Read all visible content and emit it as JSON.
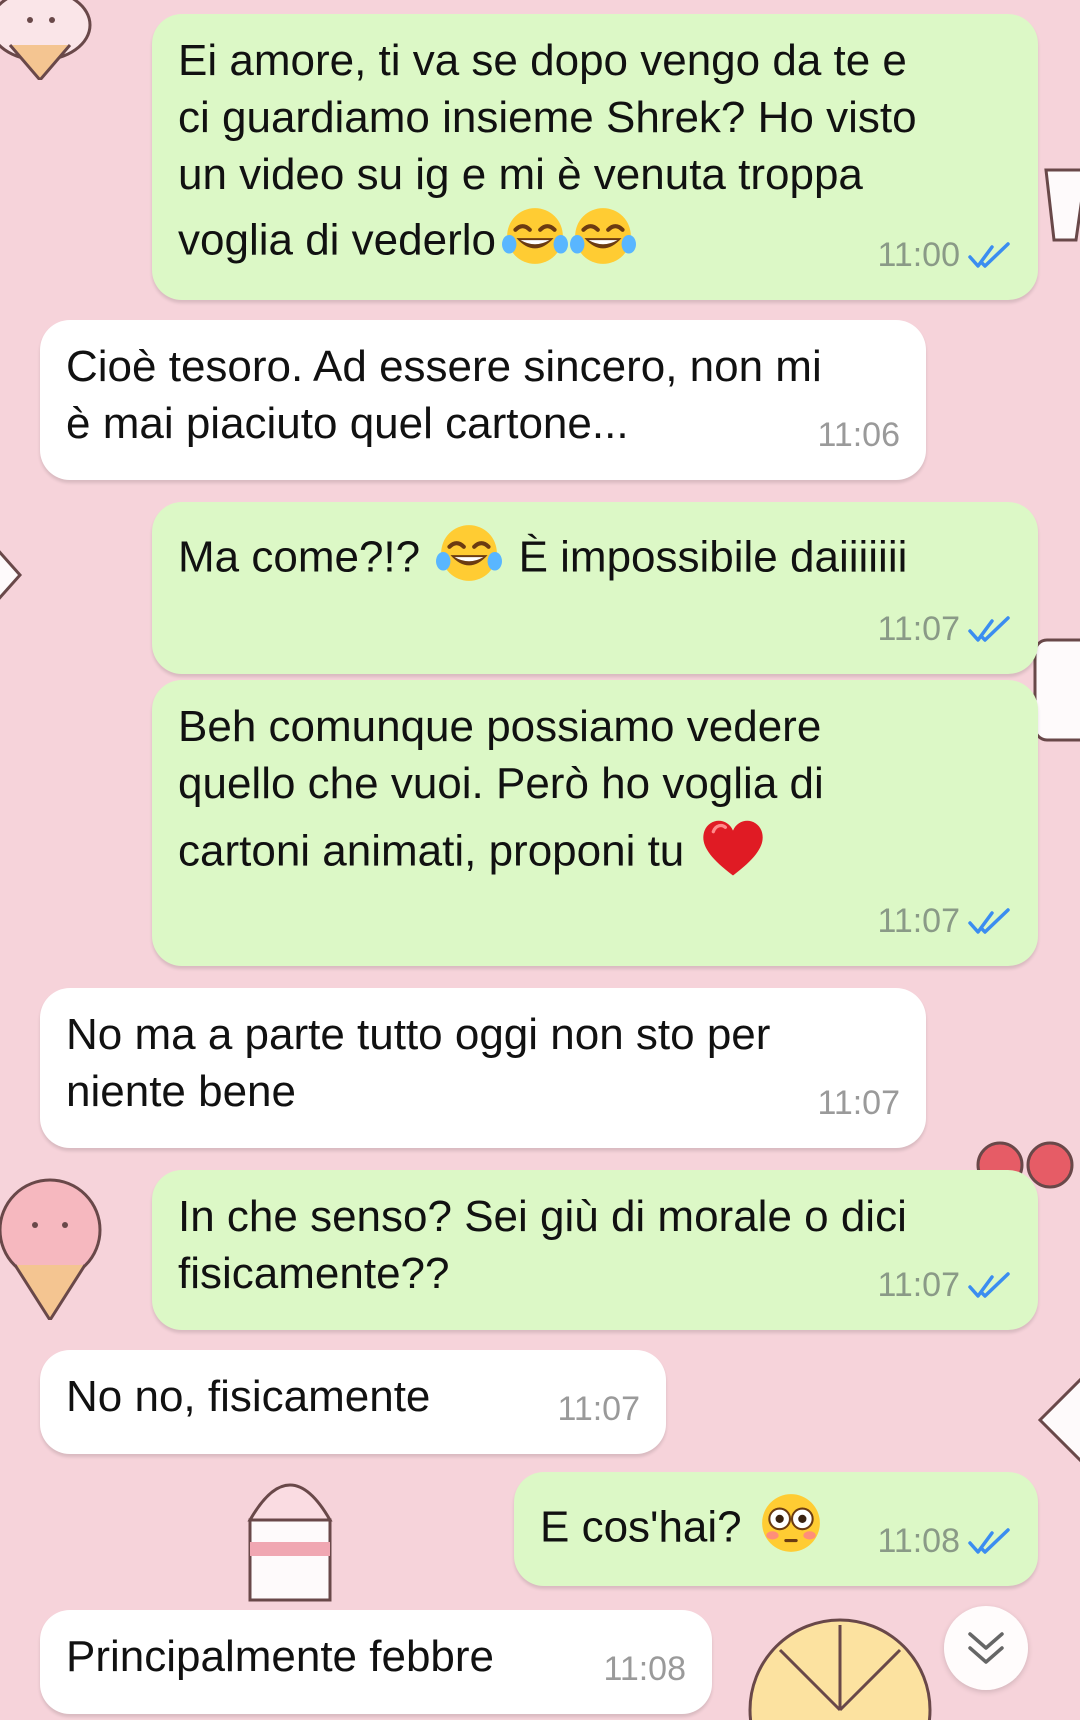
{
  "wallpaper": {
    "color": "#f6d3da"
  },
  "messages": [
    {
      "id": "m1",
      "dir": "out",
      "text": "Ei amore, ti va se dopo vengo da te e\nci guardiamo insieme Shrek? Ho visto\nun video su ig e mi è venuta troppa\nvoglia di vederlo",
      "emoji": [
        "laugh-emoji",
        "laugh-emoji"
      ],
      "time": "11:00",
      "read": true
    },
    {
      "id": "m2",
      "dir": "in",
      "text": "Cioè tesoro. Ad essere sincero, non mi\nè mai piaciuto quel cartone...",
      "time": "11:06"
    },
    {
      "id": "m3",
      "dir": "out",
      "text_before": "Ma come?!? ",
      "text_after": " È impossibile daiiiiiii",
      "emoji": [
        "laugh-emoji"
      ],
      "time": "11:07",
      "read": true
    },
    {
      "id": "m4",
      "dir": "out",
      "text": "Beh comunque possiamo vedere\nquello che vuoi. Però ho voglia di\ncartoni animati, proponi tu",
      "emoji": [
        "heart-emoji"
      ],
      "time": "11:07",
      "read": true
    },
    {
      "id": "m5",
      "dir": "in",
      "text": "No ma a parte tutto oggi non sto per\nniente bene",
      "time": "11:07"
    },
    {
      "id": "m6",
      "dir": "out",
      "text": "In che senso? Sei giù di morale o dici\nfisicamente??",
      "time": "11:07",
      "read": true
    },
    {
      "id": "m7",
      "dir": "in",
      "text": "No no, fisicamente",
      "time": "11:07"
    },
    {
      "id": "m8",
      "dir": "out",
      "text": "E cos'hai?",
      "emoji": [
        "flushed-emoji"
      ],
      "time": "11:08",
      "read": true
    },
    {
      "id": "m9",
      "dir": "in",
      "text": "Principalmente febbre",
      "time": "11:08"
    }
  ],
  "colors": {
    "outgoing": "#dcf8c6",
    "incoming": "#ffffff",
    "read_ticks": "#3b8df0"
  },
  "scroll_button": {
    "icon": "double-chevron-down-icon"
  }
}
